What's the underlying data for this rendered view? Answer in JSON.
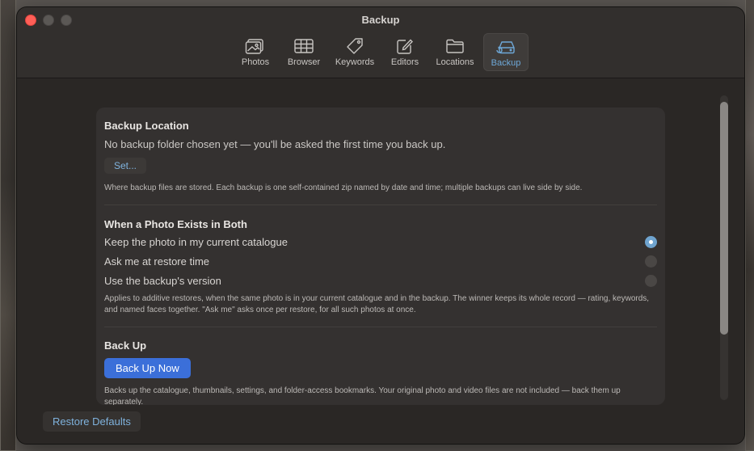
{
  "window": {
    "title": "Backup"
  },
  "toolbar": {
    "items": [
      {
        "label": "Photos",
        "icon": "photos-icon"
      },
      {
        "label": "Browser",
        "icon": "grid-icon"
      },
      {
        "label": "Keywords",
        "icon": "tag-icon"
      },
      {
        "label": "Editors",
        "icon": "pencil-square-icon"
      },
      {
        "label": "Locations",
        "icon": "folder-icon"
      },
      {
        "label": "Backup",
        "icon": "backup-drive-icon",
        "active": true
      }
    ]
  },
  "backup_location": {
    "heading": "Backup Location",
    "status": "No backup folder chosen yet — you'll be asked the first time you back up.",
    "set_button": "Set...",
    "note": "Where backup files are stored. Each backup is one self-contained zip named by date and time; multiple backups can live side by side."
  },
  "conflict": {
    "heading": "When a Photo Exists in Both",
    "options": [
      {
        "label": "Keep the photo in my current catalogue",
        "selected": true
      },
      {
        "label": "Ask me at restore time",
        "selected": false
      },
      {
        "label": "Use the backup's version",
        "selected": false
      }
    ],
    "note": "Applies to additive restores, when the same photo is in your current catalogue and in the backup. The winner keeps its whole record — rating, keywords, and named faces together. \"Ask me\" asks once per restore, for all such photos at once."
  },
  "backup": {
    "heading": "Back Up",
    "button": "Back Up Now",
    "note": "Backs up the catalogue, thumbnails, settings, and folder-access bookmarks. Your original photo and video files are not included — back them up separately."
  },
  "footer": {
    "restore_defaults": "Restore Defaults"
  },
  "colors": {
    "accent": "#3b6fd9",
    "link": "#7fb2dd",
    "radio_selected": "#6fa4cf",
    "close": "#ff5f57"
  }
}
